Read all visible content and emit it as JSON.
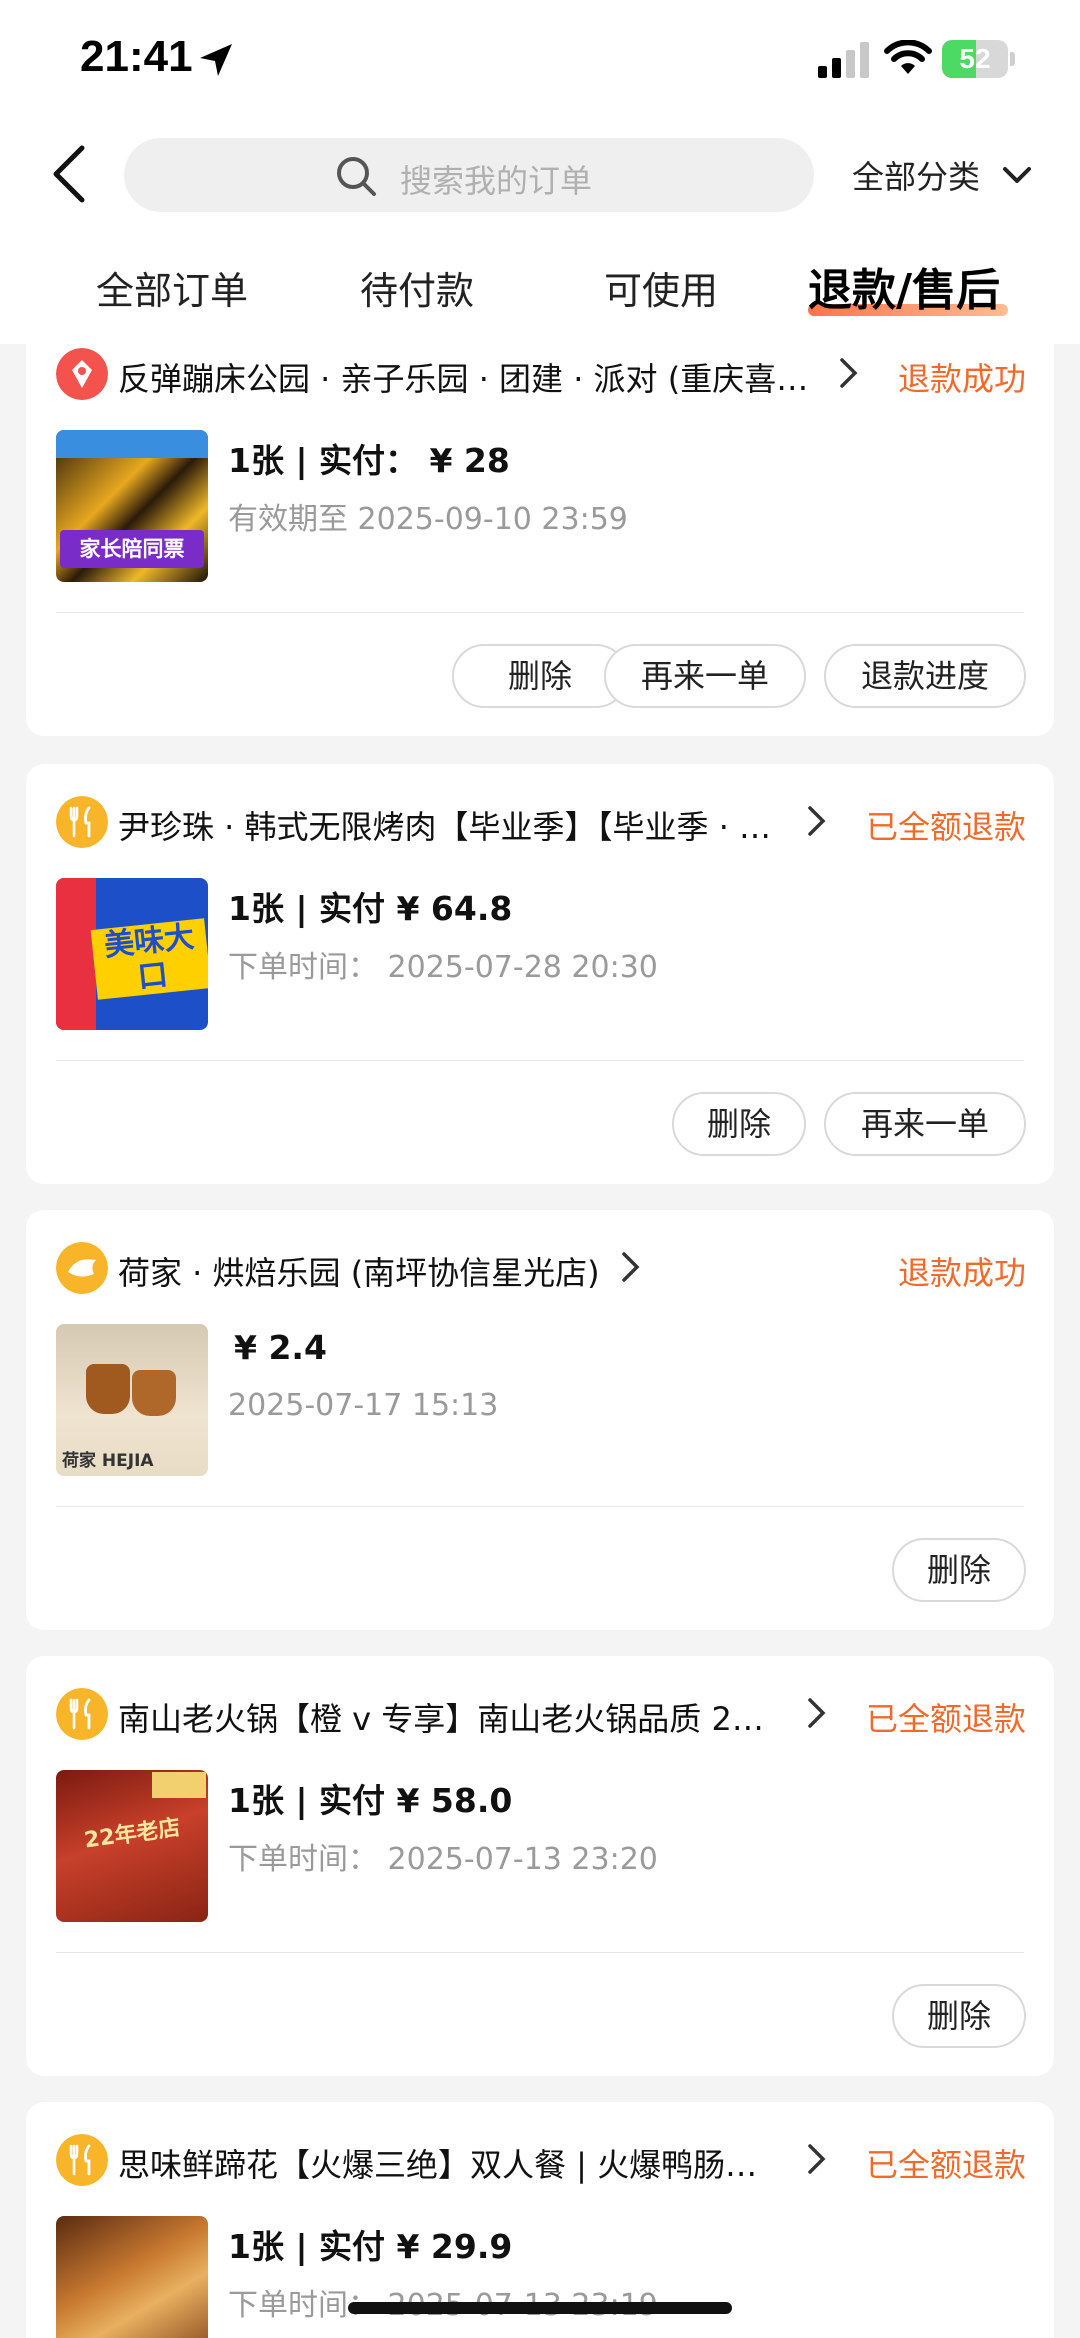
{
  "status_bar": {
    "time": "21:41",
    "battery": "52",
    "battery_level": 0.52
  },
  "search": {
    "placeholder": "搜索我的订单",
    "category": "全部分类"
  },
  "tabs": [
    "全部订单",
    "待付款",
    "可使用",
    "退款/售后"
  ],
  "colors": {
    "accent": "#f26a2a",
    "tab_underline": "#ff5a2d"
  },
  "orders": [
    {
      "icon": "ticket-icon",
      "shop": "反弹蹦床公园 · 亲子乐园 · 团建 · 派对 (重庆喜…",
      "status": "退款成功",
      "thumb_text": "家长陪同票",
      "price": "1张 | 实付： ¥ 28",
      "sub": "有效期至 2025-09-10 23:59",
      "buttons": [
        "删除",
        "再来一单",
        "退款进度"
      ]
    },
    {
      "icon": "fork-knife-icon",
      "shop": "尹珍珠 · 韩式无限烤肉【毕业季】【毕业季 · …",
      "status": "已全额退款",
      "thumb_text": "美味大口",
      "price": "1张 | 实付 ¥ 64.8",
      "sub": "下单时间：  2025-07-28 20:30",
      "buttons": [
        "删除",
        "再来一单"
      ]
    },
    {
      "icon": "bakery-icon",
      "shop": "荷家 · 烘焙乐园 (南坪协信星光店)",
      "status": "退款成功",
      "thumb_text": "荷家 HEJIA",
      "price": "¥ 2.4",
      "sub": "2025-07-17 15:13",
      "buttons": [
        "删除"
      ]
    },
    {
      "icon": "fork-knife-icon",
      "shop": "南山老火锅【橙 v 专享】南山老火锅品质 2…",
      "status": "已全额退款",
      "thumb_text": "22年老店",
      "price": "1张 | 实付 ¥ 58.0",
      "sub": "下单时间：  2025-07-13 23:20",
      "buttons": [
        "删除"
      ]
    },
    {
      "icon": "fork-knife-icon",
      "shop": "思味鲜蹄花【火爆三绝】双人餐 | 火爆鸭肠…",
      "status": "已全额退款",
      "thumb_text": "",
      "price": "1张 | 实付 ¥ 29.9",
      "sub": "下单时间：  2025-07-13 23:19",
      "buttons": []
    }
  ]
}
